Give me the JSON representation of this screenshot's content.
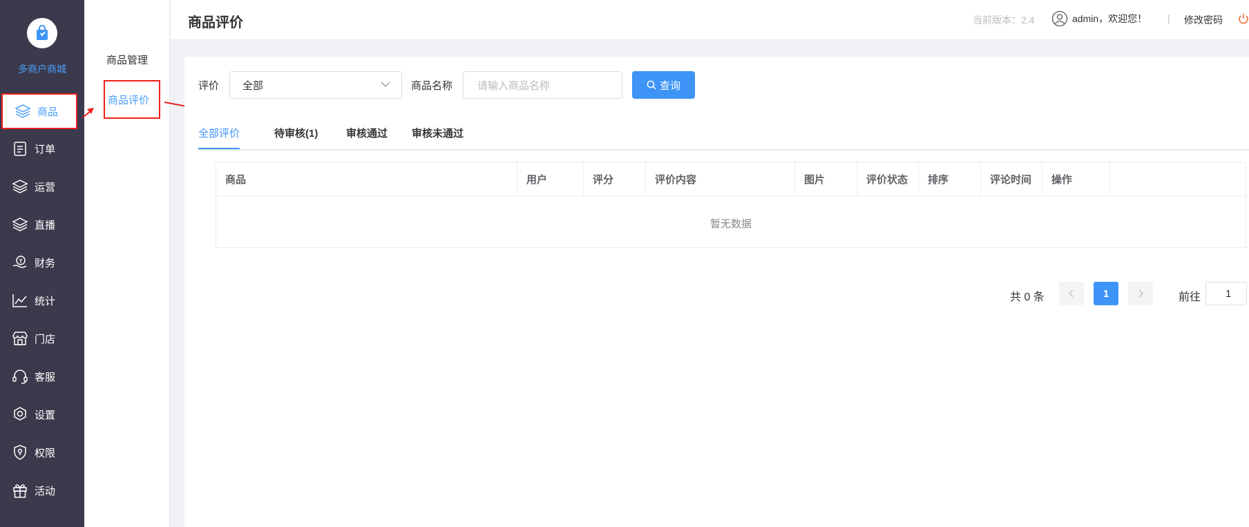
{
  "app": {
    "logo_text": "多商户商城"
  },
  "sidebar": {
    "items": [
      {
        "label": "商品",
        "icon": "layers-icon"
      },
      {
        "label": "订单",
        "icon": "clipboard-icon"
      },
      {
        "label": "运营",
        "icon": "layers-icon"
      },
      {
        "label": "直播",
        "icon": "layers-icon"
      },
      {
        "label": "财务",
        "icon": "money-hand-icon"
      },
      {
        "label": "统计",
        "icon": "line-chart-icon"
      },
      {
        "label": "门店",
        "icon": "store-icon"
      },
      {
        "label": "客服",
        "icon": "headset-icon"
      },
      {
        "label": "设置",
        "icon": "gear-icon"
      },
      {
        "label": "权限",
        "icon": "shield-icon"
      },
      {
        "label": "活动",
        "icon": "gift-icon"
      }
    ]
  },
  "subnav": {
    "items": [
      {
        "label": "商品管理"
      },
      {
        "label": "商品评价"
      }
    ]
  },
  "header": {
    "title": "商品评价",
    "version": "当前版本：2.4",
    "user": "admin，欢迎您！",
    "divider": "|",
    "change_password": "修改密码"
  },
  "filters": {
    "rating_label": "评价",
    "rating_value": "全部",
    "name_label": "商品名称",
    "name_placeholder": "请输入商品名称",
    "query_button": "查询"
  },
  "tabs": [
    {
      "label": "全部评价"
    },
    {
      "label": "待审核(1)"
    },
    {
      "label": "审核通过"
    },
    {
      "label": "审核未通过"
    }
  ],
  "table": {
    "columns": [
      "商品",
      "用户",
      "评分",
      "评价内容",
      "图片",
      "评价状态",
      "排序",
      "评论时间",
      "操作"
    ],
    "empty_text": "暂无数据"
  },
  "pagination": {
    "total": "共 0 条",
    "current_page": "1",
    "goto_label": "前往",
    "goto_value": "1"
  },
  "colors": {
    "accent": "#3d94f6",
    "sidebar_bg": "#3b3a4c",
    "highlight_red": "#f01e1e"
  }
}
